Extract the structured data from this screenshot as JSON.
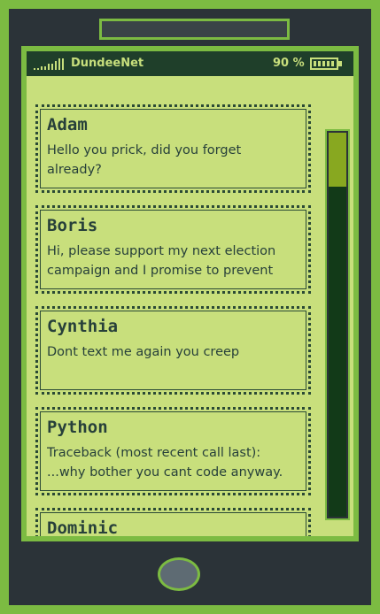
{
  "status_bar": {
    "network": "DundeeNet",
    "battery": "90 %"
  },
  "messages": [
    {
      "sender": "Adam",
      "text": "Hello you prick, did you forget already?"
    },
    {
      "sender": "Boris",
      "text": "Hi, please support my next election campaign and I promise to prevent"
    },
    {
      "sender": "Cynthia",
      "text": "Dont text me again you creep"
    },
    {
      "sender": "Python",
      "text": "Traceback (most recent call last): ...why bother you cant code anyway."
    },
    {
      "sender": "Dominic",
      "text": ""
    }
  ],
  "scrollbar": {
    "position_fraction": 0.0,
    "visible_fraction": 0.14
  },
  "colors": {
    "lcd": "#c8df7c",
    "frame": "#7cbb42",
    "body": "#2b3338",
    "status": "#1f3f2a",
    "thumb": "#88a820"
  }
}
